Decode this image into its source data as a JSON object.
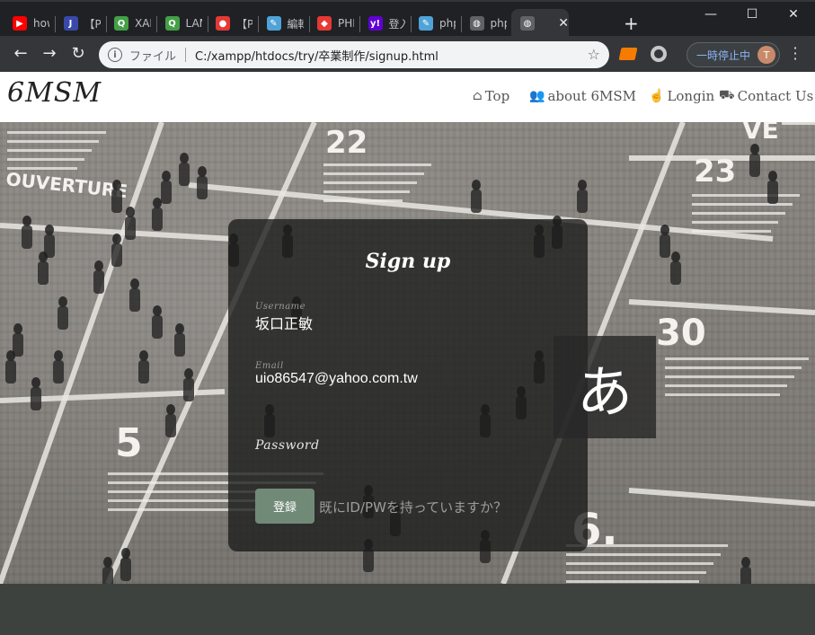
{
  "browser": {
    "tabs": [
      {
        "label": "how",
        "icon": "youtube-icon",
        "color": "#ff0000",
        "glyph": "▶"
      },
      {
        "label": "【PH",
        "icon": "j-site-icon",
        "color": "#3949ab",
        "glyph": "J"
      },
      {
        "label": "XAM",
        "icon": "xampp-icon",
        "color": "#43a047",
        "glyph": "Q"
      },
      {
        "label": "LAM",
        "icon": "lamp-icon",
        "color": "#43a047",
        "glyph": "Q"
      },
      {
        "label": "【PH",
        "icon": "redsun-icon",
        "color": "#e53935",
        "glyph": "●"
      },
      {
        "label": "編輯",
        "icon": "editor-icon",
        "color": "#4fa3d8",
        "glyph": "✎"
      },
      {
        "label": "PHP",
        "icon": "laravel-icon",
        "color": "#e53935",
        "glyph": "◆"
      },
      {
        "label": "登入",
        "icon": "yahoo-icon",
        "color": "#6001d2",
        "glyph": "y!"
      },
      {
        "label": "php",
        "icon": "php-icon",
        "color": "#4fa3d8",
        "glyph": "✎"
      },
      {
        "label": "php",
        "icon": "globe-icon",
        "color": "#5f6368",
        "glyph": "◍"
      },
      {
        "label": "",
        "icon": "globe-icon",
        "color": "#5f6368",
        "glyph": "◍"
      }
    ],
    "new_tab": "+",
    "window": {
      "minimize": "—",
      "maximize": "☐",
      "close": "✕"
    },
    "address": {
      "scheme": "ファイル",
      "url": "C:/xampp/htdocs/try/卒業制作/signup.html"
    },
    "paused_label": "一時停止中",
    "avatar_initial": "T"
  },
  "site": {
    "logo": "6MSM",
    "nav": [
      {
        "label": "Top",
        "icon": "home-icon",
        "glyph": "⌂"
      },
      {
        "label": "about 6MSM",
        "icon": "users-icon",
        "glyph": "👥"
      },
      {
        "label": "Longin",
        "icon": "hand-icon",
        "glyph": "☝"
      },
      {
        "label": "Contact Us",
        "icon": "truck-icon",
        "glyph": "⛟"
      }
    ]
  },
  "form": {
    "title": "Sign up",
    "username": {
      "label": "Username",
      "value": "坂口正敏"
    },
    "email": {
      "label": "Email",
      "value": "uio86547@yahoo.com.tw"
    },
    "password": {
      "label": "Password"
    },
    "submit_label": "登録",
    "have_account": "既にID/PWを持っていますか？"
  },
  "ime_indicator": "あ",
  "hero_numbers": [
    {
      "text": "22"
    },
    {
      "text": "23"
    },
    {
      "text": "30"
    },
    {
      "text": "5"
    },
    {
      "text": "6."
    }
  ],
  "hero_words": [
    {
      "text": "OUVERTURE"
    },
    {
      "text": "VE"
    }
  ]
}
